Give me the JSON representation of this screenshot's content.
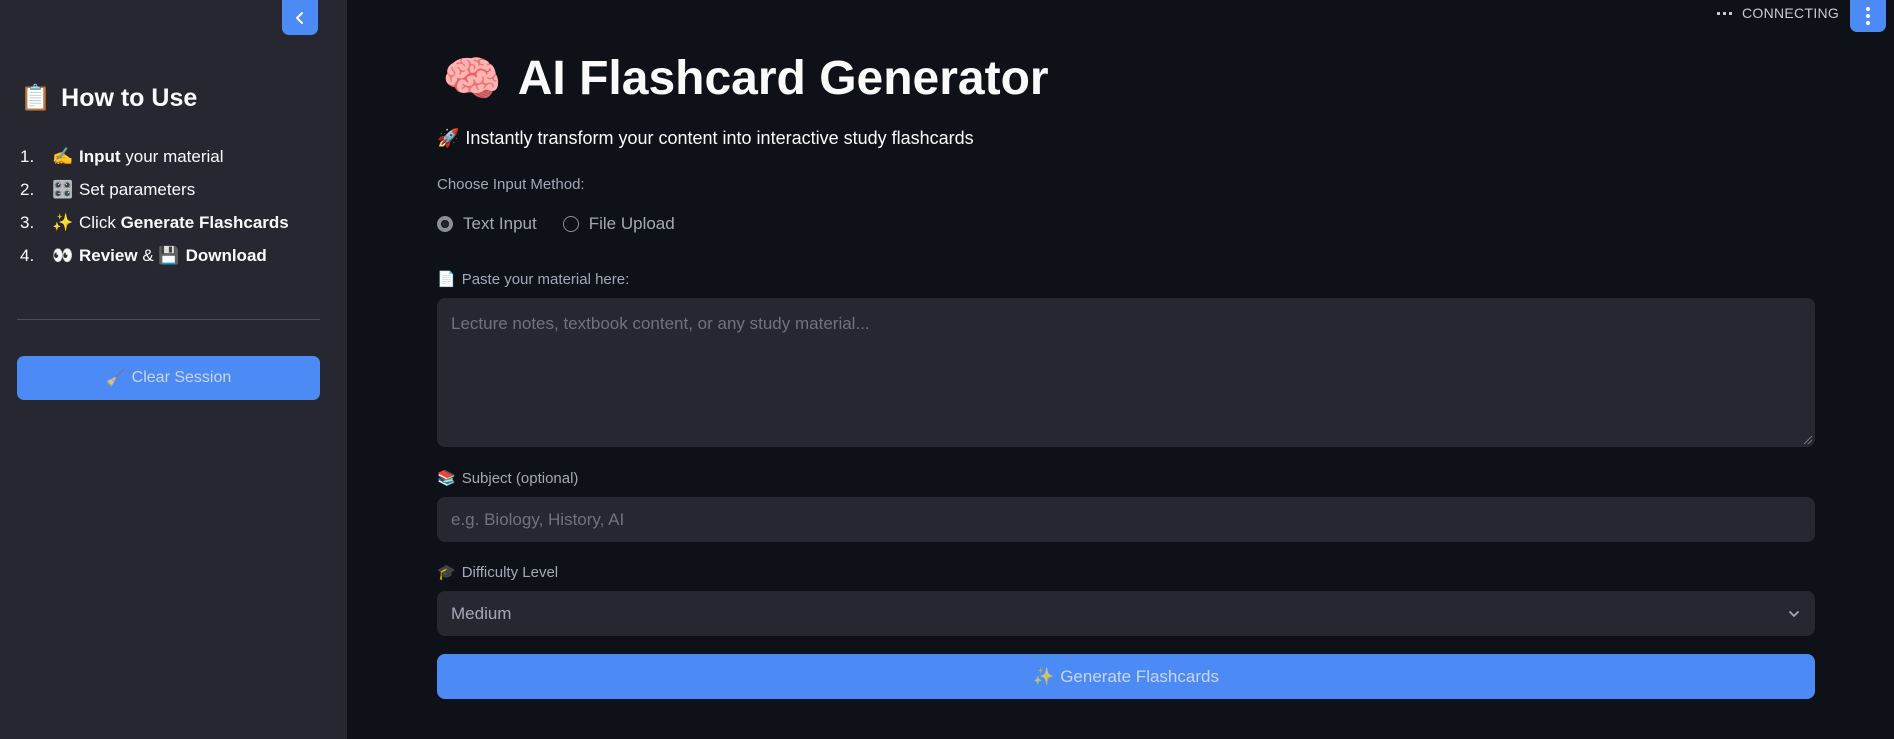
{
  "sidebar": {
    "title": "How to Use",
    "title_icon": "📋",
    "steps": [
      {
        "num": "1.",
        "icon": "✍️",
        "bold": "Input",
        "rest": " your material",
        "bold2": "",
        "icon2": ""
      },
      {
        "num": "2.",
        "icon": "🎛️",
        "bold": "",
        "rest": "Set parameters",
        "bold2": "",
        "icon2": ""
      },
      {
        "num": "3.",
        "icon": "✨",
        "bold": "",
        "rest": "Click ",
        "bold2": "Generate Flashcards",
        "icon2": ""
      },
      {
        "num": "4.",
        "icon": "👀",
        "bold": "Review",
        "rest": " & ",
        "bold2": "Download",
        "icon2": "💾"
      }
    ],
    "clear_button": {
      "icon": "🧹",
      "label": "Clear Session"
    }
  },
  "header": {
    "status": "CONNECTING"
  },
  "main": {
    "title": "AI Flashcard Generator",
    "title_icon": "🧠",
    "subtitle_icon": "🚀",
    "subtitle": "Instantly transform your content into interactive study flashcards",
    "input_method_label": "Choose Input Method:",
    "input_methods": [
      {
        "label": "Text Input",
        "selected": true
      },
      {
        "label": "File Upload",
        "selected": false
      }
    ],
    "material_label_icon": "📄",
    "material_label": "Paste your material here:",
    "material_placeholder": "Lecture notes, textbook content, or any study material...",
    "subject_label_icon": "📚",
    "subject_label": "Subject (optional)",
    "subject_placeholder": "e.g. Biology, History, AI",
    "difficulty_label_icon": "🎓",
    "difficulty_label": "Difficulty Level",
    "difficulty_value": "Medium",
    "generate_button": {
      "icon": "✨",
      "label": "Generate Flashcards"
    }
  },
  "colors": {
    "background": "#0e1117",
    "sidebar": "#262730",
    "accent": "#4c8bf5"
  }
}
